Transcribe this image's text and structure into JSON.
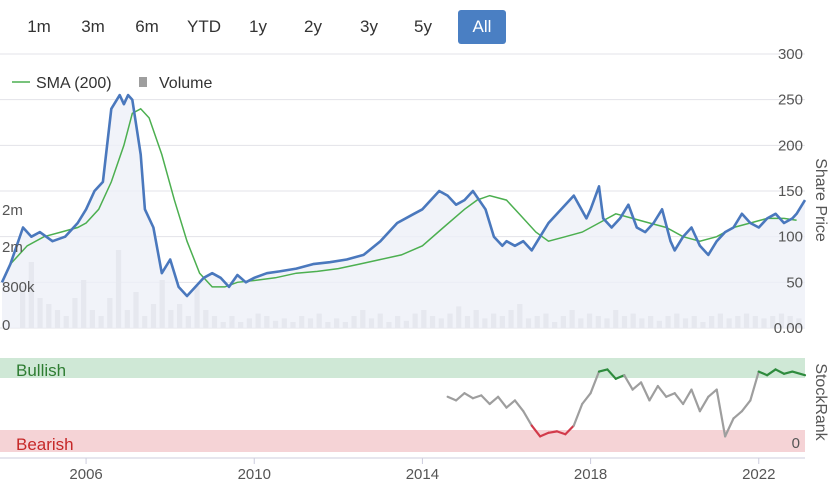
{
  "range_selector": {
    "buttons": [
      "1m",
      "3m",
      "6m",
      "YTD",
      "1y",
      "2y",
      "3y",
      "5y",
      "All"
    ],
    "active": "All"
  },
  "legend": {
    "sma_label": "SMA (200)",
    "volume_label": "Volume"
  },
  "colors": {
    "price": "#4a78bd",
    "sma": "#4caf50",
    "volume": "#c8c8cc",
    "area": "#eef0f8",
    "bullish_band": "#cfe8d6",
    "bearish_band": "#f5d3d6",
    "rank_mid": "#9e9e9e",
    "rank_high": "#2e8b3d",
    "rank_low": "#d23a4a",
    "active_button": "#4a7fc3"
  },
  "chart_data": [
    {
      "type": "line",
      "title": "",
      "xlabel": "",
      "ylabel": "Share Price",
      "y_ticks": [
        "300",
        "250",
        "200",
        "150",
        "100",
        "50",
        "0.00"
      ],
      "ylim": [
        0,
        300
      ],
      "x_ticks": [
        "2006",
        "2010",
        "2014",
        "2018",
        "2022"
      ],
      "xlim": [
        2004.0,
        2023.1
      ],
      "volume_ticks": [
        "2m",
        "2m",
        "800k",
        "0"
      ],
      "series": [
        {
          "name": "Share Price",
          "x": [
            2004.0,
            2004.2,
            2004.5,
            2004.7,
            2004.9,
            2005.2,
            2005.5,
            2005.8,
            2006.0,
            2006.2,
            2006.4,
            2006.5,
            2006.6,
            2006.8,
            2006.9,
            2007.0,
            2007.1,
            2007.2,
            2007.3,
            2007.4,
            2007.6,
            2007.8,
            2008.0,
            2008.2,
            2008.4,
            2008.6,
            2008.8,
            2009.0,
            2009.2,
            2009.4,
            2009.6,
            2009.8,
            2010.0,
            2010.3,
            2010.6,
            2011.0,
            2011.4,
            2011.8,
            2012.2,
            2012.6,
            2013.0,
            2013.4,
            2013.8,
            2014.0,
            2014.2,
            2014.4,
            2014.6,
            2014.8,
            2015.0,
            2015.2,
            2015.5,
            2015.7,
            2015.9,
            2016.0,
            2016.2,
            2016.4,
            2016.6,
            2016.8,
            2017.0,
            2017.3,
            2017.6,
            2017.9,
            2018.0,
            2018.2,
            2018.3,
            2018.5,
            2018.7,
            2018.9,
            2019.1,
            2019.3,
            2019.5,
            2019.7,
            2019.9,
            2020.0,
            2020.2,
            2020.4,
            2020.6,
            2020.8,
            2021.0,
            2021.2,
            2021.4,
            2021.6,
            2021.8,
            2022.0,
            2022.2,
            2022.4,
            2022.6,
            2022.8,
            2022.9,
            2023.1
          ],
          "values": [
            50,
            70,
            110,
            100,
            105,
            95,
            100,
            115,
            130,
            150,
            160,
            200,
            240,
            255,
            245,
            255,
            250,
            220,
            190,
            130,
            110,
            60,
            75,
            45,
            35,
            45,
            55,
            60,
            55,
            45,
            58,
            50,
            55,
            60,
            62,
            65,
            70,
            72,
            75,
            80,
            95,
            115,
            125,
            130,
            140,
            150,
            145,
            135,
            140,
            150,
            130,
            100,
            90,
            95,
            90,
            95,
            85,
            100,
            115,
            130,
            145,
            120,
            130,
            155,
            120,
            110,
            120,
            135,
            110,
            105,
            115,
            130,
            95,
            85,
            100,
            110,
            90,
            80,
            95,
            105,
            110,
            125,
            115,
            110,
            120,
            125,
            115,
            120,
            125,
            140
          ]
        },
        {
          "name": "SMA (200)",
          "x": [
            2004.2,
            2004.6,
            2005.0,
            2005.4,
            2005.8,
            2006.0,
            2006.3,
            2006.6,
            2006.9,
            2007.1,
            2007.3,
            2007.5,
            2007.8,
            2008.1,
            2008.4,
            2008.7,
            2009.0,
            2009.3,
            2009.6,
            2010.0,
            2010.5,
            2011.0,
            2011.5,
            2012.0,
            2012.5,
            2013.0,
            2013.5,
            2014.0,
            2014.5,
            2015.0,
            2015.3,
            2015.6,
            2016.0,
            2016.3,
            2016.7,
            2017.0,
            2017.4,
            2017.8,
            2018.2,
            2018.6,
            2019.0,
            2019.4,
            2019.8,
            2020.2,
            2020.6,
            2021.0,
            2021.4,
            2021.8,
            2022.2,
            2022.6,
            2022.9
          ],
          "values": [
            70,
            90,
            100,
            105,
            110,
            115,
            130,
            160,
            200,
            235,
            240,
            230,
            190,
            140,
            95,
            60,
            45,
            45,
            50,
            52,
            55,
            60,
            62,
            65,
            70,
            75,
            80,
            90,
            110,
            130,
            140,
            145,
            140,
            125,
            105,
            95,
            100,
            105,
            115,
            125,
            120,
            115,
            110,
            100,
            95,
            100,
            110,
            115,
            120,
            120,
            118
          ]
        }
      ],
      "volume_values": [
        35,
        55,
        25,
        20,
        15,
        10,
        25,
        40,
        15,
        10,
        25,
        65,
        15,
        30,
        10,
        20,
        40,
        15,
        20,
        10,
        35,
        15,
        10,
        5,
        10,
        5,
        8,
        12,
        10,
        6,
        8,
        5,
        10,
        8,
        12,
        5,
        8,
        5,
        10,
        15,
        8,
        12,
        5,
        10,
        6,
        12,
        15,
        10,
        8,
        12,
        18,
        10,
        15,
        8,
        12,
        10,
        15,
        20,
        8,
        10,
        12,
        5,
        10,
        15,
        8,
        12,
        10,
        8,
        15,
        10,
        12,
        8,
        10,
        6,
        10,
        12,
        8,
        10,
        5,
        10,
        12,
        8,
        10,
        12,
        10,
        8,
        10,
        12,
        10,
        8
      ]
    },
    {
      "type": "line",
      "title": "",
      "ylabel": "StockRank",
      "ylim": [
        0,
        100
      ],
      "zones": {
        "bullish": "Bullish",
        "bearish": "Bearish"
      },
      "y_ticks": [
        "0"
      ],
      "series": [
        {
          "name": "StockRank",
          "x": [
            2014.6,
            2014.8,
            2015.0,
            2015.2,
            2015.4,
            2015.6,
            2015.8,
            2016.0,
            2016.2,
            2016.4,
            2016.6,
            2016.8,
            2017.0,
            2017.2,
            2017.4,
            2017.6,
            2017.8,
            2018.0,
            2018.2,
            2018.4,
            2018.6,
            2018.8,
            2019.0,
            2019.2,
            2019.4,
            2019.6,
            2019.8,
            2020.0,
            2020.2,
            2020.4,
            2020.6,
            2020.8,
            2021.0,
            2021.2,
            2021.4,
            2021.6,
            2021.8,
            2022.0,
            2022.2,
            2022.4,
            2022.6,
            2022.8,
            2023.1
          ],
          "values": [
            60,
            55,
            65,
            58,
            62,
            50,
            60,
            45,
            55,
            40,
            20,
            5,
            10,
            12,
            8,
            20,
            50,
            65,
            95,
            98,
            85,
            90,
            70,
            80,
            55,
            75,
            60,
            65,
            50,
            70,
            40,
            60,
            70,
            5,
            30,
            40,
            55,
            95,
            90,
            98,
            92,
            95,
            90
          ]
        }
      ]
    }
  ]
}
